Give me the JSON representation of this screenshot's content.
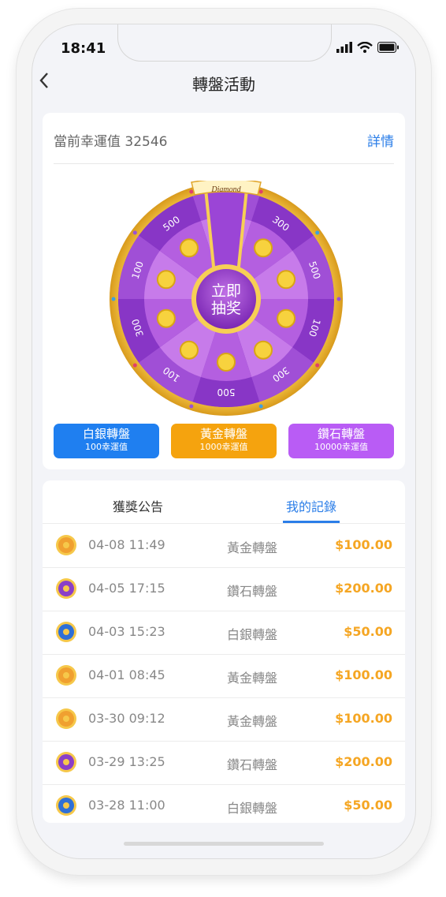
{
  "status_bar": {
    "time": "18:41"
  },
  "nav": {
    "back_icon": "chevron-left-icon",
    "title": "轉盤活動"
  },
  "luck": {
    "label": "當前幸運值",
    "value": "32546",
    "details_link": "詳情"
  },
  "wheel": {
    "banner": "Diamond",
    "center_line1": "立即",
    "center_line2": "抽奖",
    "segment_values": [
      "100",
      "300",
      "500",
      "100",
      "300",
      "500",
      "100",
      "300",
      "100",
      "500"
    ]
  },
  "wheel_buttons": [
    {
      "title": "白銀轉盤",
      "cost": "100幸運值",
      "color": "#1f7ff0"
    },
    {
      "title": "黃金轉盤",
      "cost": "1000幸運值",
      "color": "#f5a30e"
    },
    {
      "title": "鑽石轉盤",
      "cost": "10000幸運值",
      "color": "#b95cf5"
    }
  ],
  "tabs": [
    {
      "label": "獲獎公告",
      "active": false
    },
    {
      "label": "我的記錄",
      "active": true
    }
  ],
  "records": [
    {
      "date": "04-08 11:49",
      "wheel": "黃金轉盤",
      "amount": "$100.00",
      "icon_color": "#f0a030"
    },
    {
      "date": "04-05 17:15",
      "wheel": "鑽石轉盤",
      "amount": "$200.00",
      "icon_color": "#8a3fc8"
    },
    {
      "date": "04-03 15:23",
      "wheel": "白銀轉盤",
      "amount": "$50.00",
      "icon_color": "#2f6fd6"
    },
    {
      "date": "04-01 08:45",
      "wheel": "黃金轉盤",
      "amount": "$100.00",
      "icon_color": "#f0a030"
    },
    {
      "date": "03-30 09:12",
      "wheel": "黃金轉盤",
      "amount": "$100.00",
      "icon_color": "#f0a030"
    },
    {
      "date": "03-29 13:25",
      "wheel": "鑽石轉盤",
      "amount": "$200.00",
      "icon_color": "#8a3fc8"
    },
    {
      "date": "03-28 11:00",
      "wheel": "白銀轉盤",
      "amount": "$50.00",
      "icon_color": "#2f6fd6"
    }
  ]
}
